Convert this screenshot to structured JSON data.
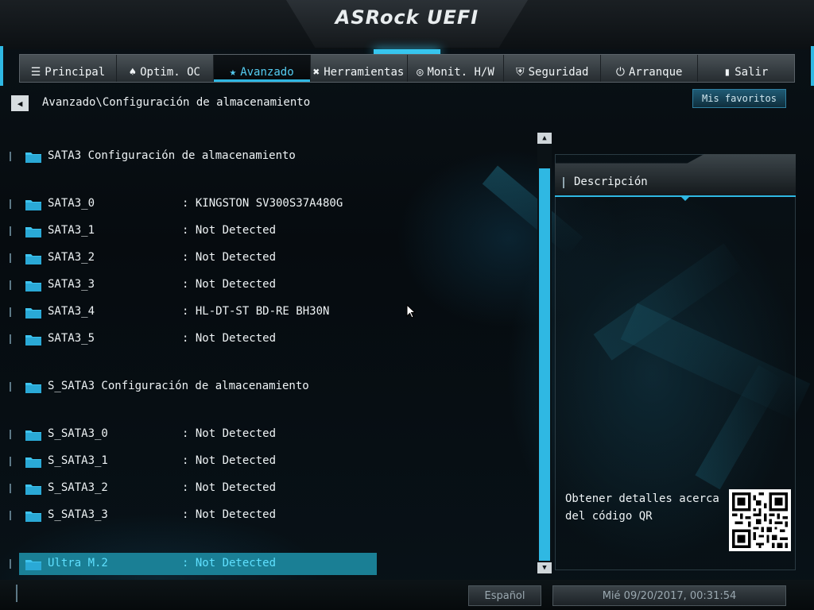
{
  "header": {
    "logo_text": "ASRock UEFI"
  },
  "nav": {
    "tabs": [
      {
        "label": "Principal",
        "icon": "list-icon",
        "glyph": "☰",
        "active": false
      },
      {
        "label": "Optim. OC",
        "icon": "rocket-icon",
        "glyph": "♠",
        "active": false
      },
      {
        "label": "Avanzado",
        "icon": "star-icon",
        "glyph": "★",
        "active": true
      },
      {
        "label": "Herramientas",
        "icon": "tools-icon",
        "glyph": "✖",
        "active": false
      },
      {
        "label": "Monit. H/W",
        "icon": "monitor-icon",
        "glyph": "◎",
        "active": false
      },
      {
        "label": "Seguridad",
        "icon": "shield-icon",
        "glyph": "⛨",
        "active": false
      },
      {
        "label": "Arranque",
        "icon": "power-icon",
        "glyph": "⏻",
        "active": false
      },
      {
        "label": "Salir",
        "icon": "exit-icon",
        "glyph": "▮",
        "active": false
      }
    ],
    "accent_color": "#2fb8e3"
  },
  "breadcrumb": {
    "path": "Avanzado\\Configuración de almacenamiento"
  },
  "favorites": {
    "label": "Mis favoritos"
  },
  "storage": {
    "section_sata3": "SATA3 Configuración de almacenamiento",
    "section_ssata3": "S_SATA3 Configuración de almacenamiento",
    "sata3_ports": [
      {
        "label": "SATA3_0",
        "value": ": KINGSTON SV300S37A480G"
      },
      {
        "label": "SATA3_1",
        "value": ": Not Detected"
      },
      {
        "label": "SATA3_2",
        "value": ": Not Detected"
      },
      {
        "label": "SATA3_3",
        "value": ": Not Detected"
      },
      {
        "label": "SATA3_4",
        "value": ": HL-DT-ST BD-RE  BH30N"
      },
      {
        "label": "SATA3_5",
        "value": ": Not Detected"
      }
    ],
    "ssata3_ports": [
      {
        "label": "S_SATA3_0",
        "value": ": Not Detected"
      },
      {
        "label": "S_SATA3_1",
        "value": ": Not Detected"
      },
      {
        "label": "S_SATA3_2",
        "value": ": Not Detected"
      },
      {
        "label": "S_SATA3_3",
        "value": ": Not Detected"
      }
    ],
    "ultra_m2": {
      "label": "Ultra M.2",
      "value": ": Not Detected",
      "selected": true
    }
  },
  "description": {
    "title": "Descripción",
    "qr_text": "Obtener detalles acerca del código QR"
  },
  "footer": {
    "language": "Español",
    "datetime": "Mié 09/20/2017, 00:31:54"
  }
}
